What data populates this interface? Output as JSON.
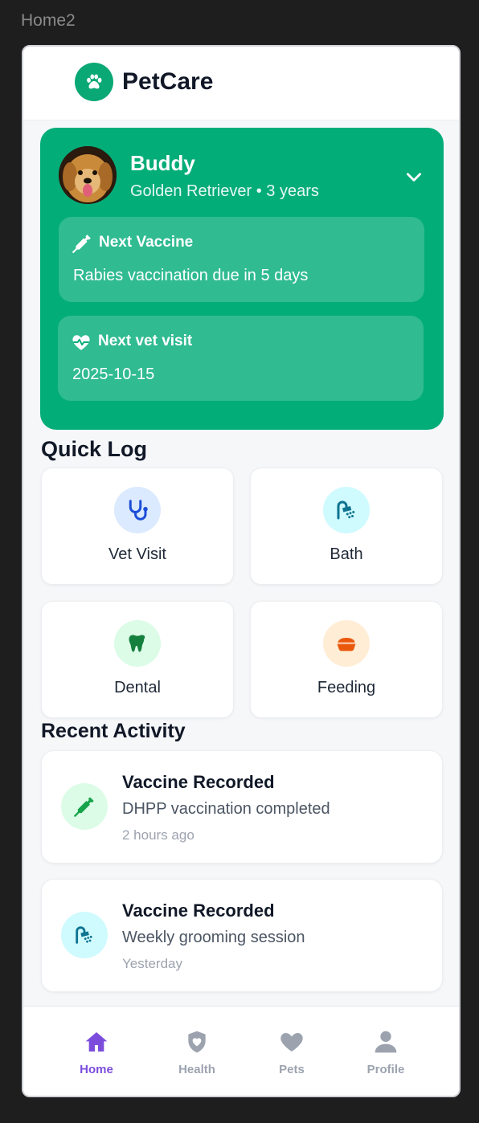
{
  "frame_label": "Home2",
  "app": {
    "name": "PetCare"
  },
  "pet": {
    "name": "Buddy",
    "subtitle": "Golden Retriever • 3 years",
    "next_vaccine": {
      "title": "Next Vaccine",
      "text": "Rabies vaccination due in 5 days"
    },
    "next_visit": {
      "title": "Next vet visit",
      "text": "2025-10-15"
    }
  },
  "quick_log": {
    "title": "Quick Log",
    "items": [
      {
        "label": "Vet Visit",
        "icon": "stethoscope-icon",
        "color": "#dbeafe"
      },
      {
        "label": "Bath",
        "icon": "shower-icon",
        "color": "#cffafe"
      },
      {
        "label": "Dental",
        "icon": "tooth-icon",
        "color": "#dcfce7"
      },
      {
        "label": "Feeding",
        "icon": "food-bowl-icon",
        "color": "#ffedd5"
      }
    ]
  },
  "recent_activity": {
    "title": "Recent Activity",
    "items": [
      {
        "title": "Vaccine Recorded",
        "desc": "DHPP vaccination completed",
        "time": "2 hours ago",
        "icon": "syringe-icon"
      },
      {
        "title": "Vaccine Recorded",
        "desc": "Weekly grooming session",
        "time": "Yesterday",
        "icon": "shower-icon"
      }
    ]
  },
  "nav": {
    "items": [
      {
        "label": "Home",
        "icon": "home-icon",
        "active": true
      },
      {
        "label": "Health",
        "icon": "shield-heart-icon",
        "active": false
      },
      {
        "label": "Pets",
        "icon": "heart-icon",
        "active": false
      },
      {
        "label": "Profile",
        "icon": "user-icon",
        "active": false
      }
    ]
  },
  "colors": {
    "brand": "#03ad78",
    "nav_active": "#7c4ddc",
    "nav_inactive": "#9ca3af"
  }
}
